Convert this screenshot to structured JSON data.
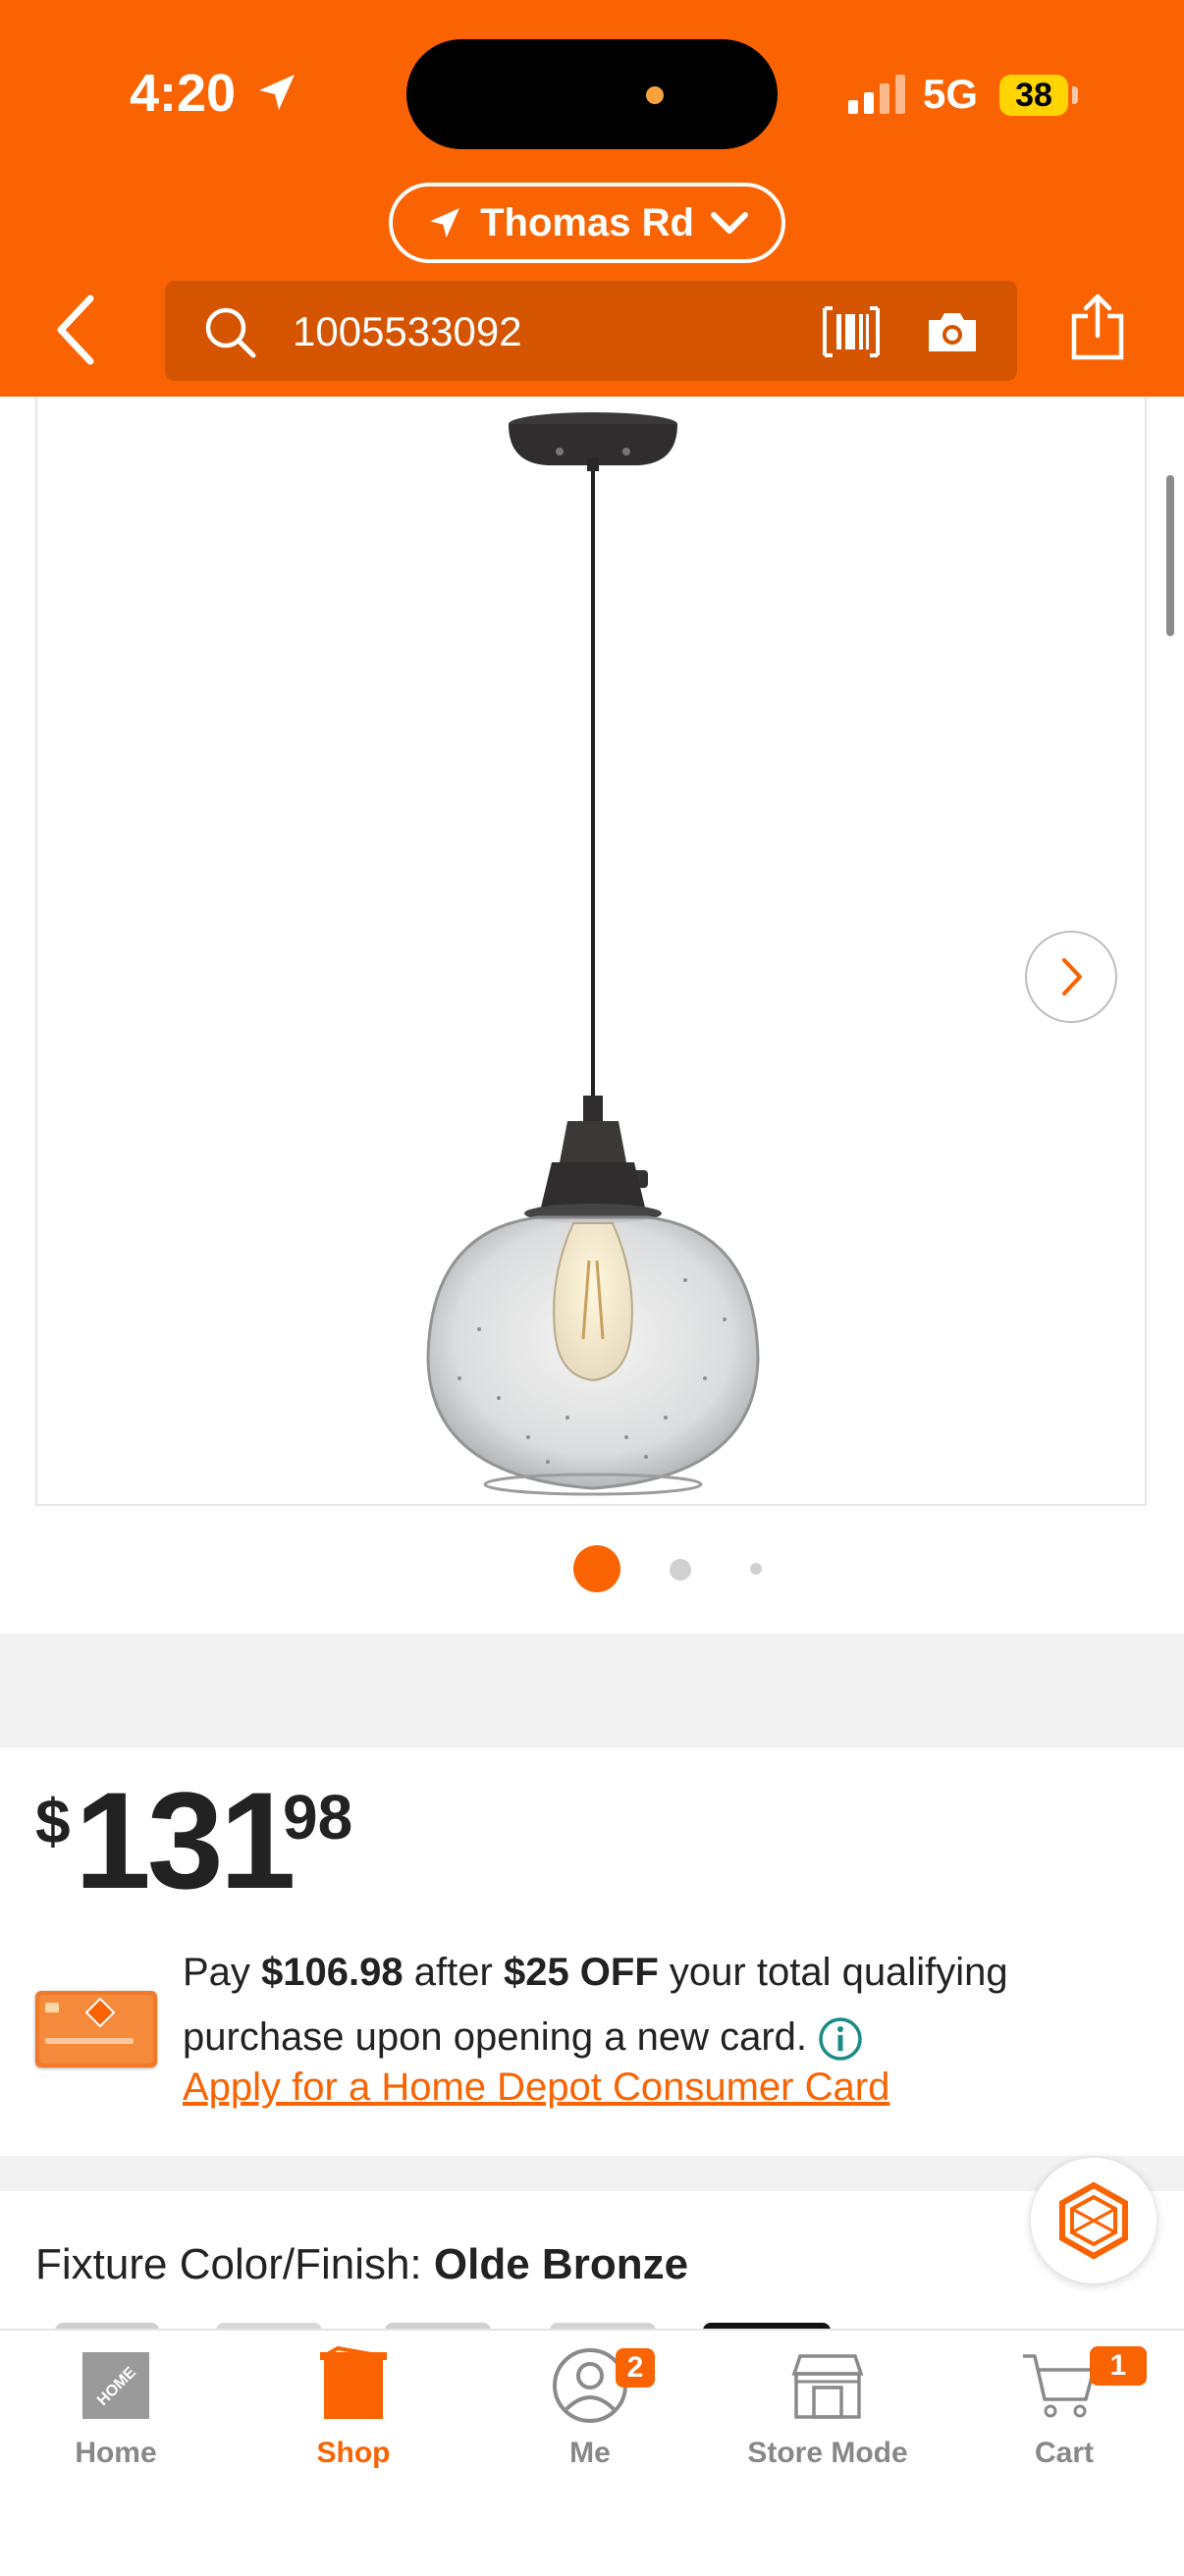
{
  "status_bar": {
    "time": "4:20",
    "network": "5G",
    "battery": "38"
  },
  "header": {
    "store_name": "Thomas Rd",
    "search_value": "1005533092"
  },
  "gallery": {
    "image_count": 3,
    "active_index": 0
  },
  "price": {
    "symbol": "$",
    "dollars": "131",
    "cents": "98"
  },
  "promo": {
    "pay_text": "Pay",
    "discounted_price": "$106.98",
    "after_text": "after",
    "discount": "$25 OFF",
    "rest_text": "your total qualifying purchase upon opening a new card.",
    "link_text": "Apply for a Home Depot Consumer Card"
  },
  "fixture": {
    "label": "Fixture Color/Finish:",
    "value": "Olde Bronze"
  },
  "tabbar": {
    "items": [
      {
        "label": "Home",
        "icon": "home-depot-logo-icon",
        "active": false
      },
      {
        "label": "Shop",
        "icon": "shop-bucket-icon",
        "active": true
      },
      {
        "label": "Me",
        "icon": "user-icon",
        "active": false,
        "badge": "2"
      },
      {
        "label": "Store Mode",
        "icon": "store-icon",
        "active": false
      },
      {
        "label": "Cart",
        "icon": "cart-icon",
        "active": false,
        "badge": "1"
      }
    ]
  },
  "colors": {
    "brand": "#f96302",
    "header_dark": "#d45400"
  }
}
